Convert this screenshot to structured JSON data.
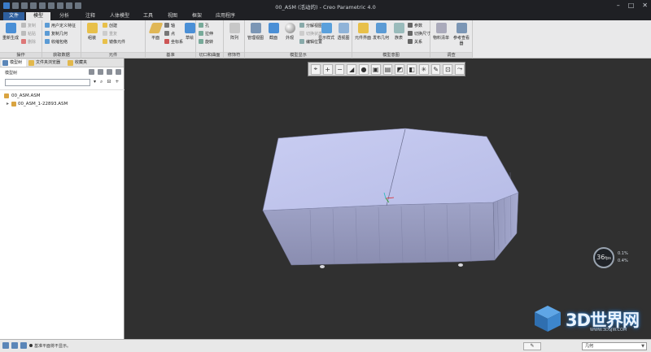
{
  "window": {
    "title": "00_ASM (活动的) - Creo Parametric 4.0"
  },
  "tabs": [
    {
      "label": "文件"
    },
    {
      "label": "模型"
    },
    {
      "label": "分析"
    },
    {
      "label": "注释"
    },
    {
      "label": "人体模型"
    },
    {
      "label": "工具"
    },
    {
      "label": "视图"
    },
    {
      "label": "框架"
    },
    {
      "label": "应用程序"
    }
  ],
  "ribbon": {
    "groups": [
      {
        "label": "操作",
        "items": [
          "重新生成",
          "复制",
          "粘贴",
          "删除"
        ]
      },
      {
        "label": "获取数据",
        "items": [
          "用户定义特征",
          "复制几何",
          "收缩包络"
        ]
      },
      {
        "label": "元件",
        "items": [
          "组装",
          "创建",
          "重复",
          "镜像元件"
        ]
      },
      {
        "label": "基准",
        "items": [
          "平面",
          "轴",
          "点",
          "坐标系",
          "草绘"
        ]
      },
      {
        "label": "切口和曲面",
        "items": [
          "孔",
          "拉伸",
          "旋转"
        ]
      },
      {
        "label": "修饰符",
        "items": [
          "阵列"
        ]
      },
      {
        "label": "模型显示",
        "items": [
          "管理视图",
          "截面",
          "外观",
          "分解视图",
          "编辑位置",
          "显示样式",
          "透视图"
        ]
      },
      {
        "label": "模型意图",
        "items": [
          "元件界面",
          "发布几何",
          "族表",
          "参数",
          "切换尺寸",
          "关系"
        ]
      },
      {
        "label": "调查",
        "items": [
          "物料清单",
          "参考查看器"
        ]
      }
    ]
  },
  "nav": {
    "tabs": [
      "模型树",
      "文件夹浏览器",
      "收藏夹"
    ],
    "tree_header": "模型树",
    "search_placeholder": "",
    "tree": [
      {
        "label": "00_ASM.ASM"
      },
      {
        "label": "00_ASM_1-22893.ASM"
      }
    ]
  },
  "viewport": {
    "fps": "36",
    "fps_unit": "fps",
    "readout_top": "0.1%",
    "readout_bottom": "0.4%"
  },
  "watermark": {
    "main": "3D世界网",
    "sub": "WWW.3DSJW.COM"
  },
  "status": {
    "message": "基准平面将不显示。",
    "selection_filter": "几何",
    "filter_icon": "✎"
  }
}
